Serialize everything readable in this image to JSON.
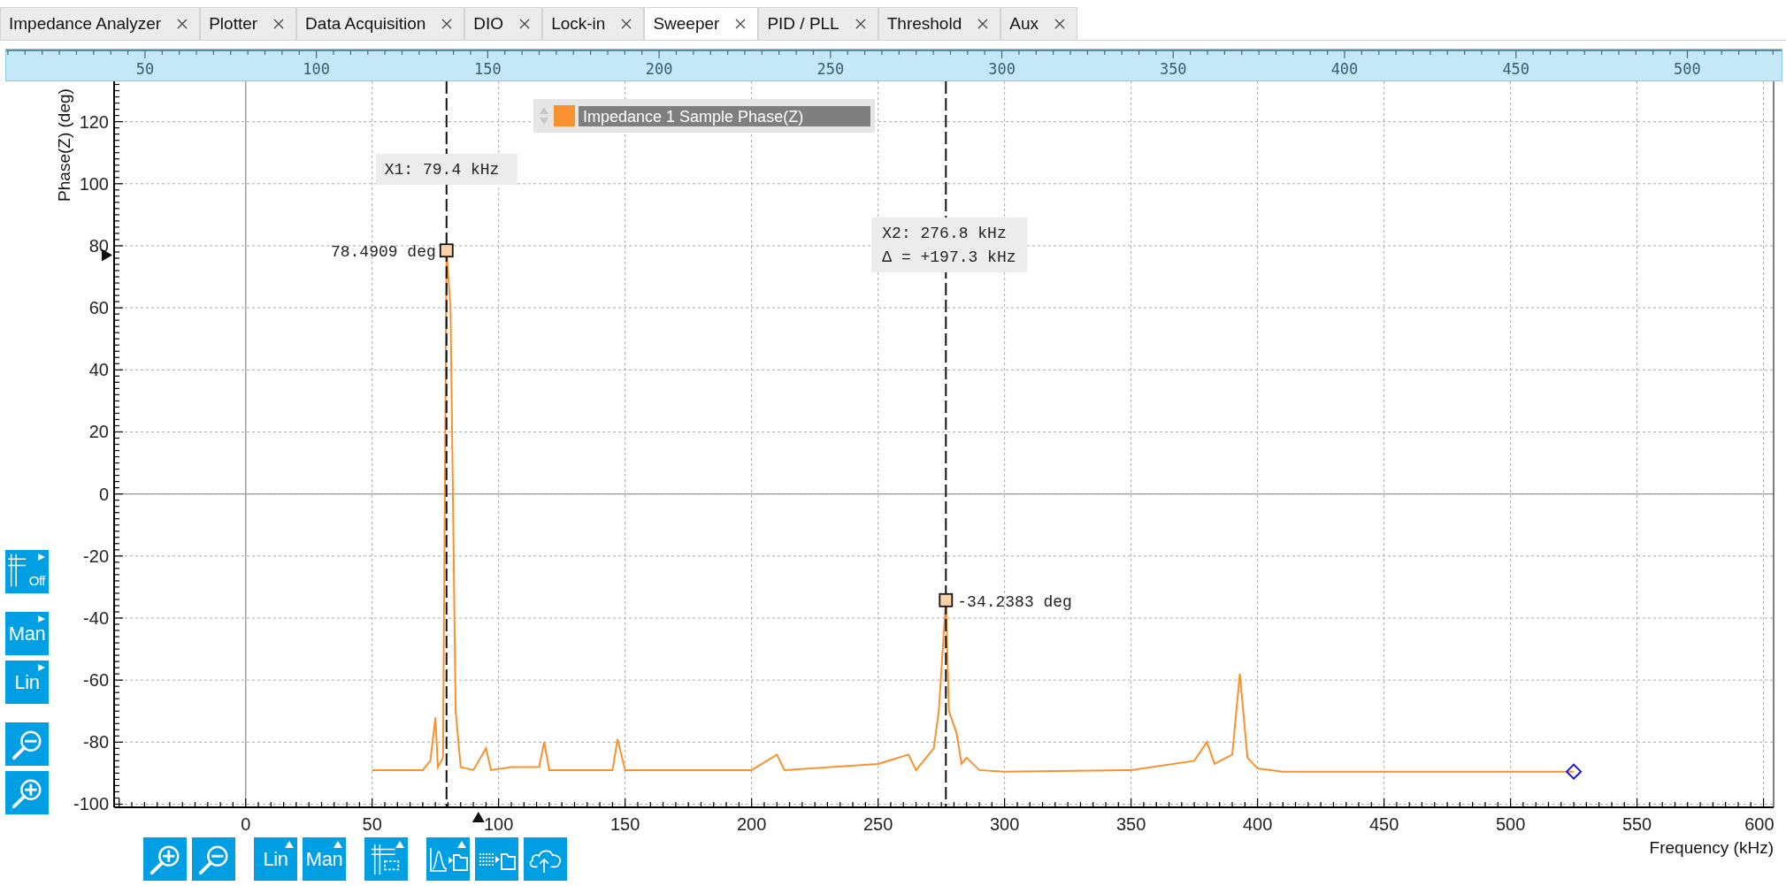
{
  "tabs": [
    {
      "label": "Impedance Analyzer",
      "selected": false
    },
    {
      "label": "Plotter",
      "selected": false
    },
    {
      "label": "Data Acquisition",
      "selected": false
    },
    {
      "label": "DIO",
      "selected": false
    },
    {
      "label": "Lock-in",
      "selected": false
    },
    {
      "label": "Sweeper",
      "selected": true
    },
    {
      "label": "PID / PLL",
      "selected": false
    },
    {
      "label": "Threshold",
      "selected": false
    },
    {
      "label": "Aux",
      "selected": false
    }
  ],
  "overview": {
    "ticks": [
      "50",
      "100",
      "150",
      "200",
      "250",
      "300",
      "350",
      "400",
      "450",
      "500"
    ]
  },
  "left_toolbar": [
    [
      {
        "kind": "grid",
        "label": "Off",
        "has_menu": true
      }
    ],
    [
      {
        "kind": "text",
        "label": "Man",
        "has_menu": true
      },
      {
        "kind": "text",
        "label": "Lin",
        "has_menu": true
      }
    ],
    [
      {
        "kind": "zoom_out",
        "has_menu": false
      },
      {
        "kind": "zoom_in",
        "has_menu": false
      }
    ]
  ],
  "plot": {
    "chart_data": {
      "type": "line",
      "xlabel": "Frequency (kHz)",
      "ylabel": "Phase(Z) (deg)",
      "xlim": [
        -52,
        604
      ],
      "ylim": [
        -101,
        133
      ],
      "grid": true,
      "xticks": [
        0,
        50,
        100,
        150,
        200,
        250,
        300,
        350,
        400,
        450,
        500,
        550,
        600
      ],
      "yticks": [
        -100,
        -80,
        -60,
        -40,
        -20,
        0,
        20,
        40,
        60,
        80,
        100,
        120
      ],
      "x": [
        50,
        70,
        73,
        75,
        76,
        78,
        79.4,
        81,
        83,
        85,
        90,
        95,
        97,
        105,
        116,
        118,
        120,
        145,
        147,
        150,
        200,
        210,
        213,
        250,
        262,
        265,
        272,
        274,
        276.8,
        278,
        281,
        283,
        285,
        290,
        300,
        350,
        375,
        380,
        383,
        390,
        393,
        396,
        400,
        410,
        525
      ],
      "series": [
        {
          "name": "Impedance 1 Sample Phase(Z)",
          "color": "#f7922e",
          "values": [
            -89,
            -89,
            -86,
            -72,
            -88,
            -85,
            78.5,
            60,
            -70,
            -88,
            -89,
            -82,
            -89,
            -88,
            -88,
            -80,
            -89,
            -89,
            -79,
            -89,
            -89,
            -84,
            -89,
            -87,
            -84,
            -89,
            -82,
            -70,
            -34.2,
            -70,
            -77,
            -87,
            -85,
            -89,
            -89.5,
            -89,
            -86,
            -80,
            -87,
            -84,
            -58,
            -85,
            -88.5,
            -89.5,
            -89.5
          ]
        }
      ],
      "ref_lines": [
        {
          "axis": "x",
          "value": 79.4,
          "label": "X1: 79.4 kHz",
          "color": "#111111"
        },
        {
          "axis": "x",
          "value": 276.8,
          "label": "X2: 276.8 kHz\nΔ = +197.3 kHz",
          "color": "#111111"
        }
      ],
      "annotations": [
        {
          "x": 79.4,
          "y": 78.4909,
          "text": "78.4909 deg"
        },
        {
          "x": 276.8,
          "y": -34.2383,
          "text": "-34.2383 deg"
        }
      ]
    }
  },
  "bottom_toolbar": [
    [
      {
        "kind": "zoom_in",
        "has_menu": false
      },
      {
        "kind": "zoom_out",
        "has_menu": false
      }
    ],
    [
      {
        "kind": "text",
        "label": "Lin",
        "has_menu": true
      },
      {
        "kind": "text",
        "label": "Man",
        "has_menu": true
      }
    ],
    [
      {
        "kind": "grid_cursor",
        "has_menu": true
      }
    ],
    [
      {
        "kind": "export_plot",
        "has_menu": true
      },
      {
        "kind": "export_table",
        "has_menu": false
      },
      {
        "kind": "cloud",
        "has_menu": false
      }
    ]
  ]
}
